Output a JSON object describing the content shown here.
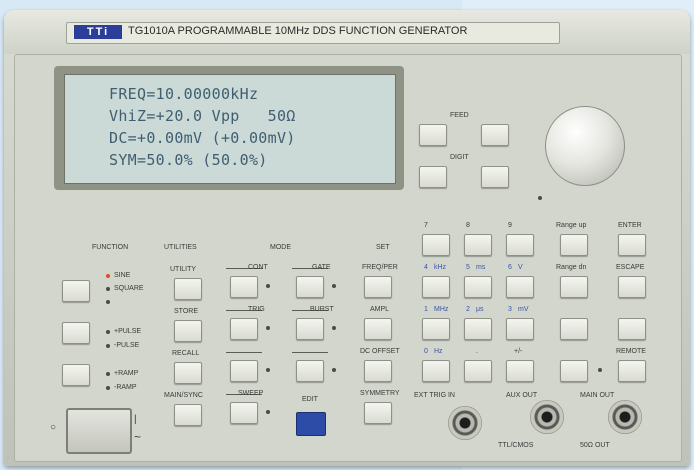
{
  "panel": {
    "logo": "TTi",
    "title": "TG1010A PROGRAMMABLE 10MHz DDS FUNCTION GENERATOR"
  },
  "display": {
    "line1": "FREQ=10.00000kHz",
    "line2": "VhiZ=+20.0 Vpp   50Ω",
    "line3": "DC=+0.00mV (+0.00mV)",
    "line4": "SYM=50.0% (50.0%)"
  },
  "labels": {
    "function": "FUNCTION",
    "utilities": "UTILITIES",
    "mode": "MODE",
    "set": "SET",
    "feed": "FEED",
    "digit": "DIGIT",
    "enter": "ENTER",
    "escape": "ESCAPE",
    "edit": "EDIT",
    "sine": "SINE",
    "square": "SQUARE",
    "pos_pulse": "+PULSE",
    "neg_pulse": "-PULSE",
    "pos_ramp": "+RAMP",
    "neg_ramp": "-RAMP",
    "utility": "UTILITY",
    "store": "STORE",
    "recall": "RECALL",
    "main_sync": "MAIN/SYNC",
    "cont": "CONT",
    "gate": "GATE",
    "trig": "TRIG",
    "burst": "BURST",
    "sweep": "SWEEP",
    "freq_per": "FREQ/PER",
    "ampl": "AMPL",
    "dc_offset": "DC OFFSET",
    "symmetry": "SYMMETRY",
    "freq_kHz": "kHz",
    "freq_Hz": "Hz",
    "freq_MHz": "MHz",
    "freq_s": "s",
    "freq_ms": "ms",
    "freq_us": "μs",
    "freq_mV": "mV",
    "freq_V": "V",
    "range_up": "Range up",
    "range_dn": "Range dn",
    "remote": "REMOTE",
    "ext_trig_in": "EXT TRIG IN",
    "aux_out": "AUX OUT",
    "main_out": "MAIN OUT",
    "ttl_cmos": "TTL/CMOS",
    "ohm_50": "50Ω OUT"
  },
  "keypad": {
    "k7": "7",
    "k8": "8",
    "k9": "9",
    "k4": "4",
    "k5": "5",
    "k6": "6",
    "k1": "1",
    "k2": "2",
    "k3": "3",
    "k0": "0",
    "kdot": ".",
    "kneg": "+/-"
  }
}
